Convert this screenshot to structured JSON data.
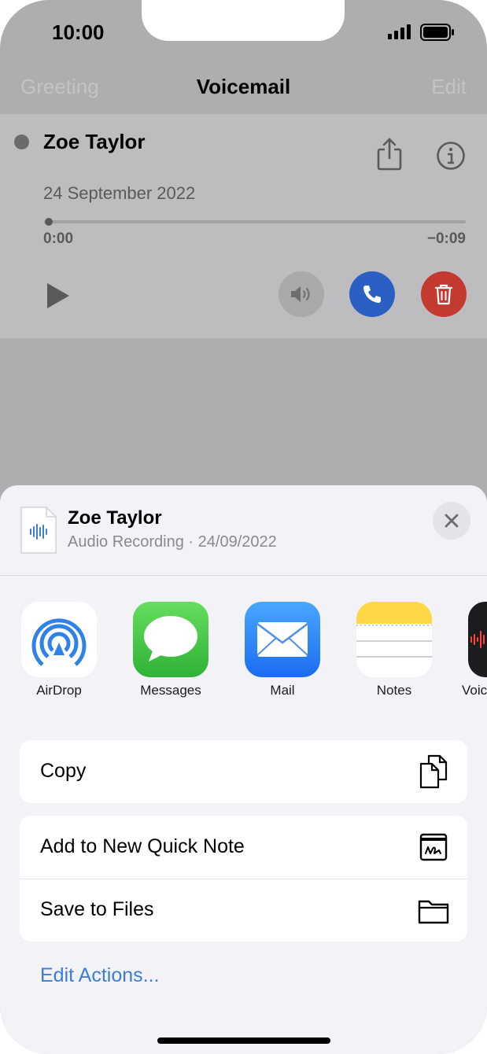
{
  "status_bar": {
    "time": "10:00"
  },
  "nav": {
    "left": "Greeting",
    "title": "Voicemail",
    "right": "Edit"
  },
  "voicemail": {
    "name": "Zoe Taylor",
    "date": "24 September 2022",
    "time_elapsed": "0:00",
    "time_remaining": "−0:09",
    "progress": 0.0
  },
  "share_sheet": {
    "title": "Zoe Taylor",
    "subtitle": "Audio Recording · 24/09/2022",
    "apps": [
      {
        "label": "AirDrop",
        "icon": "airdrop-icon"
      },
      {
        "label": "Messages",
        "icon": "messages-icon"
      },
      {
        "label": "Mail",
        "icon": "mail-icon"
      },
      {
        "label": "Notes",
        "icon": "notes-icon"
      },
      {
        "label": "Voic",
        "icon": "voice-memos-icon"
      }
    ],
    "actions": {
      "copy": "Copy",
      "quick_note": "Add to New Quick Note",
      "save_files": "Save to Files"
    },
    "edit_actions": "Edit Actions..."
  },
  "colors": {
    "accent": "#3b7dd8",
    "call": "#2b5fc4",
    "delete": "#c43a31",
    "messages": "#4cd964",
    "notes": "#ffd60a"
  }
}
